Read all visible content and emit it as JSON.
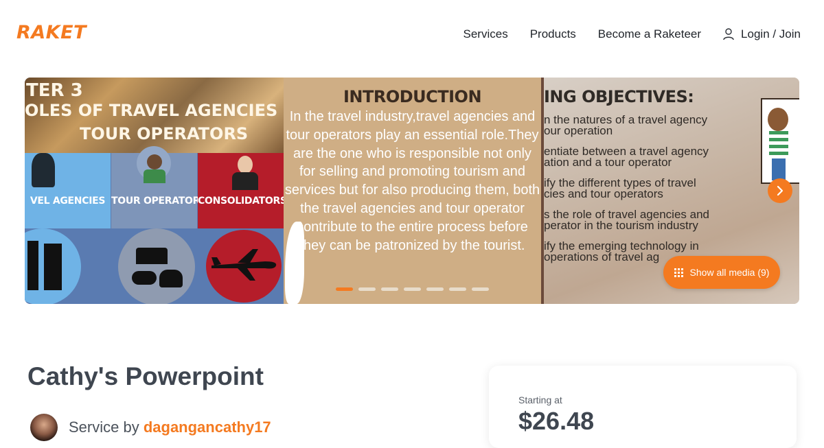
{
  "brand": {
    "name": "RAKET",
    "accent": "#f47a20"
  },
  "nav": {
    "items": [
      "Services",
      "Products",
      "Become a Raketeer"
    ],
    "login_label": "Login / Join"
  },
  "gallery": {
    "slide1": {
      "chapter": "TER 3",
      "line1": "OLES OF TRAVEL AGENCIES",
      "line2": "TOUR OPERATORS",
      "cells": [
        "VEL AGENCIES",
        "TOUR OPERATORS",
        "CONSOLIDATORS"
      ]
    },
    "slide2": {
      "title": "INTRODUCTION",
      "body": "In the travel industry,travel agencies and tour operators play an essential role.They are the one who is responsible not only for selling and promoting tourism and services but for also producing them, both the travel agencies and tour operator contribute  to the entire process before they can be patronized by the tourist."
    },
    "slide3": {
      "title": "ING OBJECTIVES:",
      "items": [
        [
          "n the natures of a travel agency",
          "our operation"
        ],
        [
          "entiate between a travel agency",
          "ation and a tour operator"
        ],
        [
          "ify the different types of travel",
          "cies and tour operators"
        ],
        [
          "s the role of travel agencies and",
          "perator in the tourism industry"
        ],
        [
          "ify the emerging technology in",
          "operations of travel ag"
        ]
      ]
    },
    "dots_count": 7,
    "active_dot": 0,
    "show_media_label": "Show all media (9)"
  },
  "service": {
    "title": "Cathy's Powerpoint",
    "by_prefix": "Service by ",
    "username": "dagangancathy17"
  },
  "pricing": {
    "label": "Starting at",
    "price": "$26.48"
  }
}
